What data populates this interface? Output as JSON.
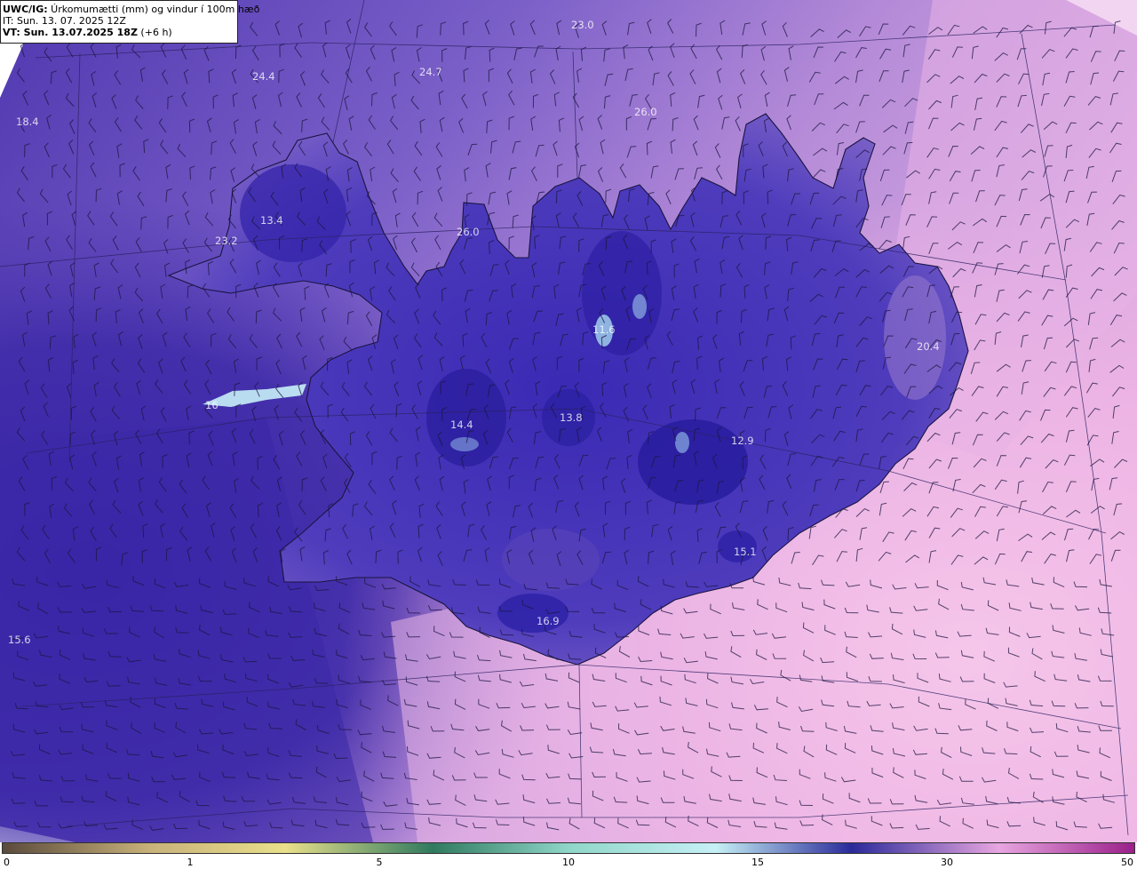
{
  "header": {
    "title_bold": "UWC/IG:",
    "title_rest": " Úrkomumætti (mm) og vindur í 100m hæð",
    "it_line": "IT: Sun. 13. 07. 2025 12Z",
    "vt_bold": "VT: Sun. 13.07.2025 18Z",
    "vt_rest": " (+6 h)"
  },
  "map_labels": [
    {
      "text": "23.0"
    },
    {
      "text": "24.4"
    },
    {
      "text": "24.7"
    },
    {
      "text": "26.0"
    },
    {
      "text": "18.4"
    },
    {
      "text": "13.4"
    },
    {
      "text": "23.2"
    },
    {
      "text": "26.0"
    },
    {
      "text": "11.6"
    },
    {
      "text": "20.4"
    },
    {
      "text": "16"
    },
    {
      "text": "14.4"
    },
    {
      "text": "13.8"
    },
    {
      "text": "12.9"
    },
    {
      "text": "15.1"
    },
    {
      "text": "16.9"
    },
    {
      "text": "15.6"
    }
  ],
  "colorbar": {
    "ticks": [
      "0",
      "1",
      "5",
      "10",
      "15",
      "30",
      "50"
    ],
    "colors": [
      "#5a4a3c",
      "#c8b27a",
      "#e9e08a",
      "#2f7a5f",
      "#8fd6c8",
      "#c6f0f6",
      "#2a2a9a",
      "#e8a6e0",
      "#9a1f8a"
    ]
  },
  "colors": {
    "sea_deep": "#3b2a9e",
    "sea_mid": "#6b55c0",
    "lilac": "#a985d6",
    "pink": "#f0b8e6",
    "land_blue": "#3a2cb0",
    "coast": "#1a1440"
  }
}
